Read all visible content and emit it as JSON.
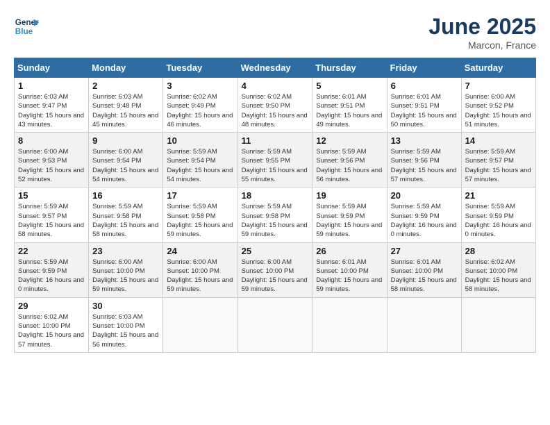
{
  "header": {
    "logo_line1": "General",
    "logo_line2": "Blue",
    "month_year": "June 2025",
    "location": "Marcon, France"
  },
  "days_of_week": [
    "Sunday",
    "Monday",
    "Tuesday",
    "Wednesday",
    "Thursday",
    "Friday",
    "Saturday"
  ],
  "weeks": [
    [
      {
        "day": 1,
        "sunrise": "6:03 AM",
        "sunset": "9:47 PM",
        "daylight": "15 hours and 43 minutes."
      },
      {
        "day": 2,
        "sunrise": "6:03 AM",
        "sunset": "9:48 PM",
        "daylight": "15 hours and 45 minutes."
      },
      {
        "day": 3,
        "sunrise": "6:02 AM",
        "sunset": "9:49 PM",
        "daylight": "15 hours and 46 minutes."
      },
      {
        "day": 4,
        "sunrise": "6:02 AM",
        "sunset": "9:50 PM",
        "daylight": "15 hours and 48 minutes."
      },
      {
        "day": 5,
        "sunrise": "6:01 AM",
        "sunset": "9:51 PM",
        "daylight": "15 hours and 49 minutes."
      },
      {
        "day": 6,
        "sunrise": "6:01 AM",
        "sunset": "9:51 PM",
        "daylight": "15 hours and 50 minutes."
      },
      {
        "day": 7,
        "sunrise": "6:00 AM",
        "sunset": "9:52 PM",
        "daylight": "15 hours and 51 minutes."
      }
    ],
    [
      {
        "day": 8,
        "sunrise": "6:00 AM",
        "sunset": "9:53 PM",
        "daylight": "15 hours and 52 minutes."
      },
      {
        "day": 9,
        "sunrise": "6:00 AM",
        "sunset": "9:54 PM",
        "daylight": "15 hours and 54 minutes."
      },
      {
        "day": 10,
        "sunrise": "5:59 AM",
        "sunset": "9:54 PM",
        "daylight": "15 hours and 54 minutes."
      },
      {
        "day": 11,
        "sunrise": "5:59 AM",
        "sunset": "9:55 PM",
        "daylight": "15 hours and 55 minutes."
      },
      {
        "day": 12,
        "sunrise": "5:59 AM",
        "sunset": "9:56 PM",
        "daylight": "15 hours and 56 minutes."
      },
      {
        "day": 13,
        "sunrise": "5:59 AM",
        "sunset": "9:56 PM",
        "daylight": "15 hours and 57 minutes."
      },
      {
        "day": 14,
        "sunrise": "5:59 AM",
        "sunset": "9:57 PM",
        "daylight": "15 hours and 57 minutes."
      }
    ],
    [
      {
        "day": 15,
        "sunrise": "5:59 AM",
        "sunset": "9:57 PM",
        "daylight": "15 hours and 58 minutes."
      },
      {
        "day": 16,
        "sunrise": "5:59 AM",
        "sunset": "9:58 PM",
        "daylight": "15 hours and 58 minutes."
      },
      {
        "day": 17,
        "sunrise": "5:59 AM",
        "sunset": "9:58 PM",
        "daylight": "15 hours and 59 minutes."
      },
      {
        "day": 18,
        "sunrise": "5:59 AM",
        "sunset": "9:58 PM",
        "daylight": "15 hours and 59 minutes."
      },
      {
        "day": 19,
        "sunrise": "5:59 AM",
        "sunset": "9:59 PM",
        "daylight": "15 hours and 59 minutes."
      },
      {
        "day": 20,
        "sunrise": "5:59 AM",
        "sunset": "9:59 PM",
        "daylight": "16 hours and 0 minutes."
      },
      {
        "day": 21,
        "sunrise": "5:59 AM",
        "sunset": "9:59 PM",
        "daylight": "16 hours and 0 minutes."
      }
    ],
    [
      {
        "day": 22,
        "sunrise": "5:59 AM",
        "sunset": "9:59 PM",
        "daylight": "16 hours and 0 minutes."
      },
      {
        "day": 23,
        "sunrise": "6:00 AM",
        "sunset": "10:00 PM",
        "daylight": "15 hours and 59 minutes."
      },
      {
        "day": 24,
        "sunrise": "6:00 AM",
        "sunset": "10:00 PM",
        "daylight": "15 hours and 59 minutes."
      },
      {
        "day": 25,
        "sunrise": "6:00 AM",
        "sunset": "10:00 PM",
        "daylight": "15 hours and 59 minutes."
      },
      {
        "day": 26,
        "sunrise": "6:01 AM",
        "sunset": "10:00 PM",
        "daylight": "15 hours and 59 minutes."
      },
      {
        "day": 27,
        "sunrise": "6:01 AM",
        "sunset": "10:00 PM",
        "daylight": "15 hours and 58 minutes."
      },
      {
        "day": 28,
        "sunrise": "6:02 AM",
        "sunset": "10:00 PM",
        "daylight": "15 hours and 58 minutes."
      }
    ],
    [
      {
        "day": 29,
        "sunrise": "6:02 AM",
        "sunset": "10:00 PM",
        "daylight": "15 hours and 57 minutes."
      },
      {
        "day": 30,
        "sunrise": "6:03 AM",
        "sunset": "10:00 PM",
        "daylight": "15 hours and 56 minutes."
      },
      null,
      null,
      null,
      null,
      null
    ]
  ]
}
